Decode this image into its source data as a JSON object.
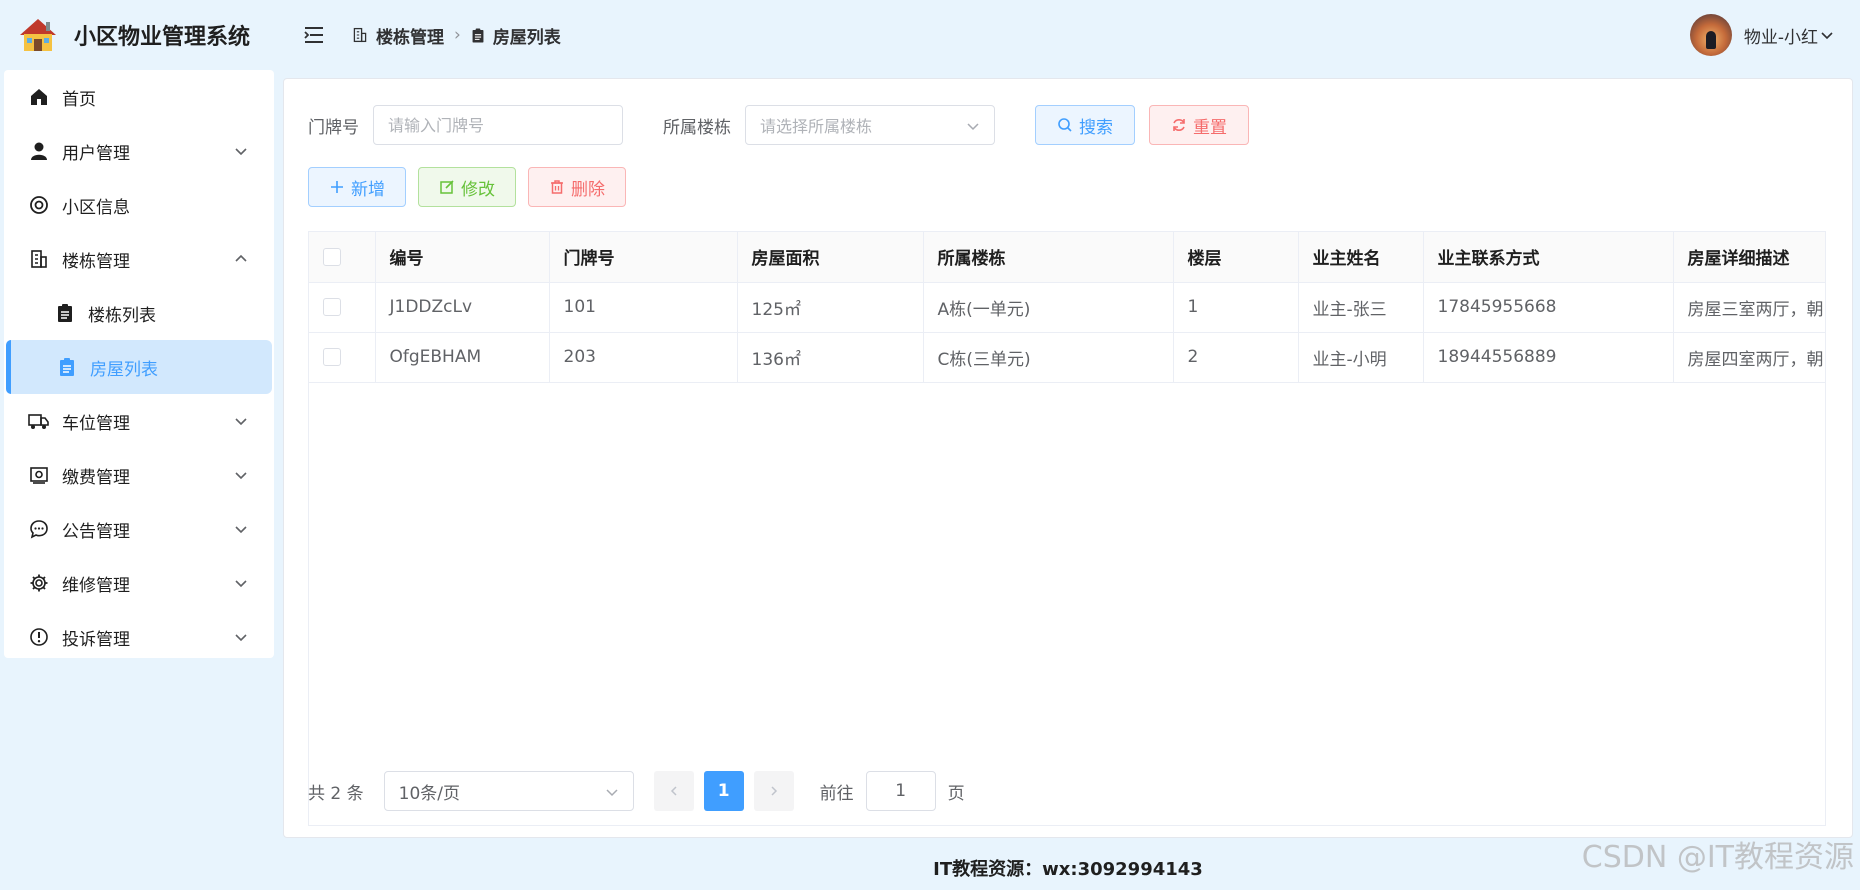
{
  "app": {
    "title": "小区物业管理系统"
  },
  "sidebar": {
    "items": [
      {
        "label": "首页",
        "icon": "home-icon"
      },
      {
        "label": "用户管理",
        "icon": "user-icon",
        "expandable": true
      },
      {
        "label": "小区信息",
        "icon": "lifebuoy-icon"
      },
      {
        "label": "楼栋管理",
        "icon": "building-icon",
        "expandable": true,
        "expanded": true
      },
      {
        "label": "楼栋列表",
        "icon": "clipboard-icon",
        "sub": true
      },
      {
        "label": "房屋列表",
        "icon": "clipboard-icon",
        "sub": true,
        "active": true
      },
      {
        "label": "车位管理",
        "icon": "truck-icon",
        "expandable": true
      },
      {
        "label": "缴费管理",
        "icon": "wallet-icon",
        "expandable": true
      },
      {
        "label": "公告管理",
        "icon": "chat-icon",
        "expandable": true
      },
      {
        "label": "维修管理",
        "icon": "gear-icon",
        "expandable": true
      },
      {
        "label": "投诉管理",
        "icon": "warning-icon",
        "expandable": true
      }
    ]
  },
  "header": {
    "breadcrumb": [
      "楼栋管理",
      "房屋列表"
    ],
    "user_name": "物业-小红"
  },
  "search": {
    "door_label": "门牌号",
    "door_placeholder": "请输入门牌号",
    "building_label": "所属楼栋",
    "building_placeholder": "请选择所属楼栋",
    "search_btn": "搜索",
    "reset_btn": "重置"
  },
  "actions": {
    "add": "新增",
    "edit": "修改",
    "delete": "删除"
  },
  "table": {
    "columns": [
      "编号",
      "门牌号",
      "房屋面积",
      "所属楼栋",
      "楼层",
      "业主姓名",
      "业主联系方式",
      "房屋详细描述"
    ],
    "rows": [
      [
        "J1DDZcLv",
        "101",
        "125㎡",
        "A栋(一单元)",
        "1",
        "业主-张三",
        "17845955668",
        "房屋三室两厅，朝"
      ],
      [
        "OfgEBHAM",
        "203",
        "136㎡",
        "C栋(三单元)",
        "2",
        "业主-小明",
        "18944556889",
        "房屋四室两厅，朝"
      ]
    ]
  },
  "pagination": {
    "total": "共 2 条",
    "page_size": "10条/页",
    "current": "1",
    "goto_label": "前往",
    "goto_value": "1",
    "page_suffix": "页"
  },
  "footer": {
    "text": "IT教程资源：wx:3092994143"
  },
  "watermark": "CSDN @IT教程资源",
  "colors": {
    "primary": "#409eff",
    "danger": "#f56c6c",
    "success": "#67c23a",
    "bg": "#e8f4fd"
  }
}
